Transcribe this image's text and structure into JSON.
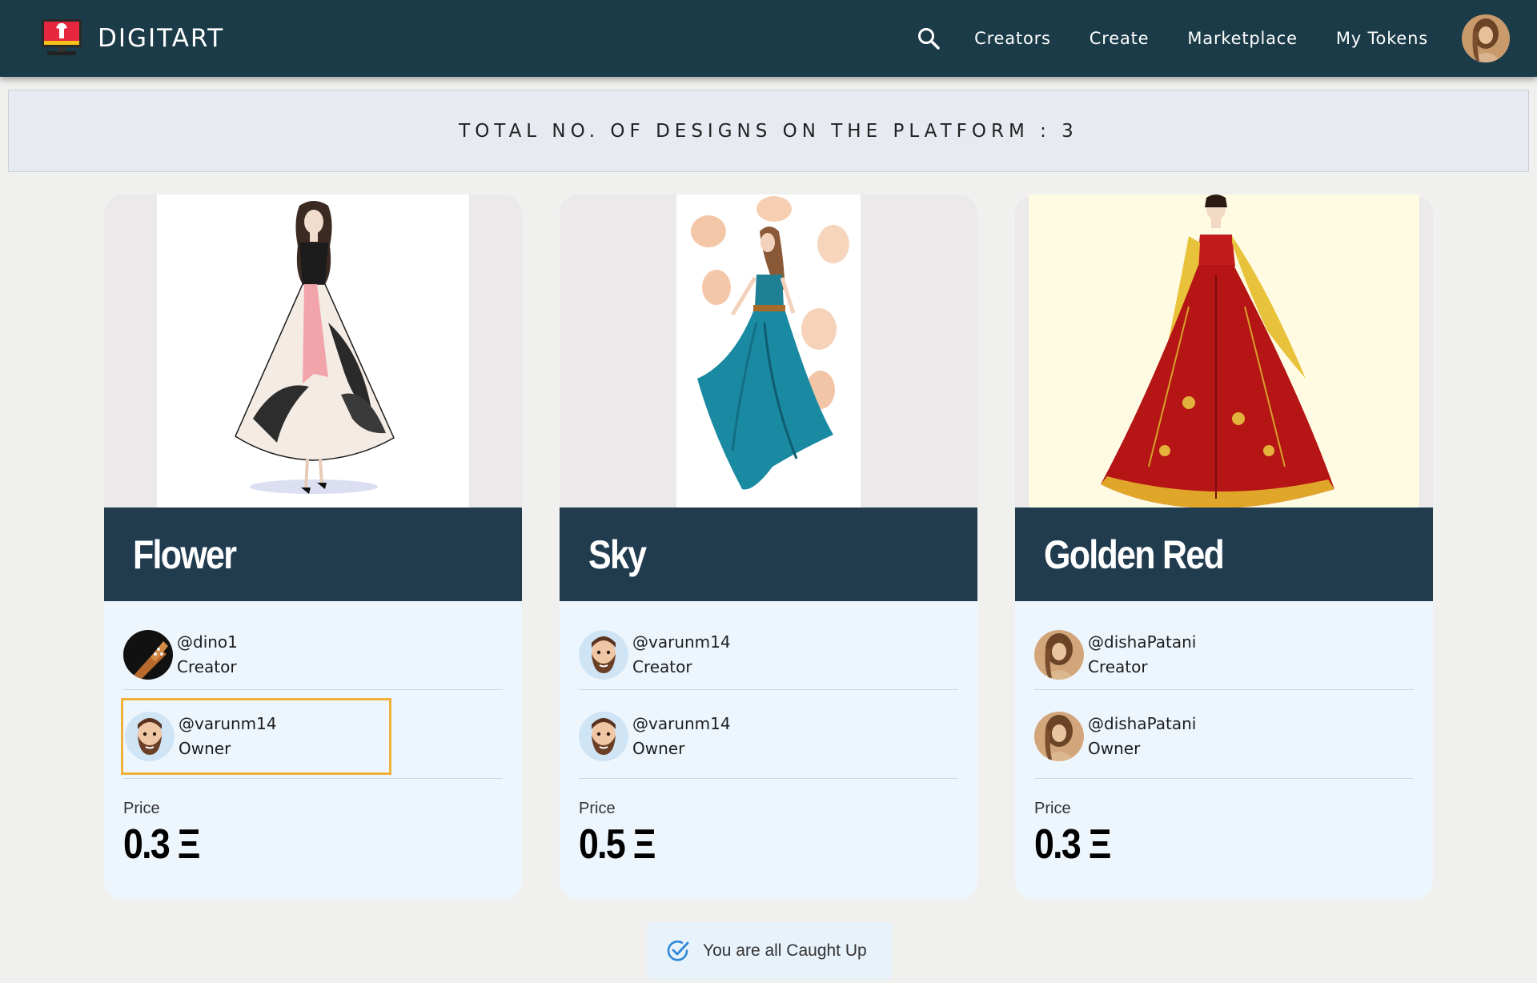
{
  "app": {
    "brand_name": "DIGITART",
    "accent": "#1b3b48"
  },
  "nav": {
    "links": [
      "Creators",
      "Create",
      "Marketplace",
      "My Tokens"
    ],
    "icons": {
      "search": "search-icon",
      "avatar": "user-avatar"
    }
  },
  "banner": {
    "text": "TOTAL NO. OF DESIGNS ON THE PLATFORM : 3"
  },
  "cards": [
    {
      "title": "Flower",
      "creator": {
        "handle": "@dino1",
        "role": "Creator"
      },
      "owner": {
        "handle": "@varunm14",
        "role": "Owner"
      },
      "price_label": "Price",
      "price": "0.3 Ξ"
    },
    {
      "title": "Sky",
      "creator": {
        "handle": "@varunm14",
        "role": "Creator"
      },
      "owner": {
        "handle": "@varunm14",
        "role": "Owner"
      },
      "price_label": "Price",
      "price": "0.5 Ξ"
    },
    {
      "title": "Golden Red",
      "creator": {
        "handle": "@dishaPatani",
        "role": "Creator"
      },
      "owner": {
        "handle": "@dishaPatani",
        "role": "Owner"
      },
      "price_label": "Price",
      "price": "0.3 Ξ"
    }
  ],
  "footer": {
    "caught_up": "You are all Caught Up",
    "icon": "check-circle-icon"
  }
}
